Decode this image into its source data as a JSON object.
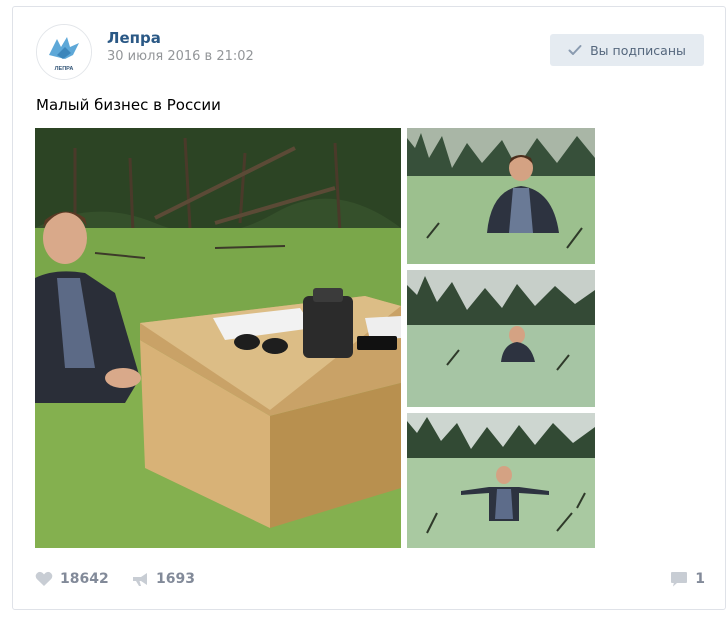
{
  "post": {
    "community": {
      "name": "Лепра",
      "avatar_label": "ЛЕПРА"
    },
    "date": "30 июля 2016 в 21:02",
    "subscribe_button": {
      "label": "Вы подписаны",
      "icon": "check-icon"
    },
    "text": "Малый бизнес в России",
    "photos": [
      {
        "id": "main",
        "icon": "photo"
      },
      {
        "id": "thumb-1",
        "icon": "photo"
      },
      {
        "id": "thumb-2",
        "icon": "photo"
      },
      {
        "id": "thumb-3",
        "icon": "photo"
      }
    ],
    "footer": {
      "likes": "18642",
      "likes_icon": "heart-icon",
      "shares": "1693",
      "shares_icon": "megaphone-icon",
      "comments": "1",
      "comments_icon": "comment-icon"
    }
  },
  "colors": {
    "name_link": "#2a5885",
    "meta_gray": "#939699",
    "button_bg": "#e5ebf1",
    "footer_gray": "#828a99",
    "swamp_green": "#6f9a44",
    "forest_dark": "#2f4a2a"
  }
}
